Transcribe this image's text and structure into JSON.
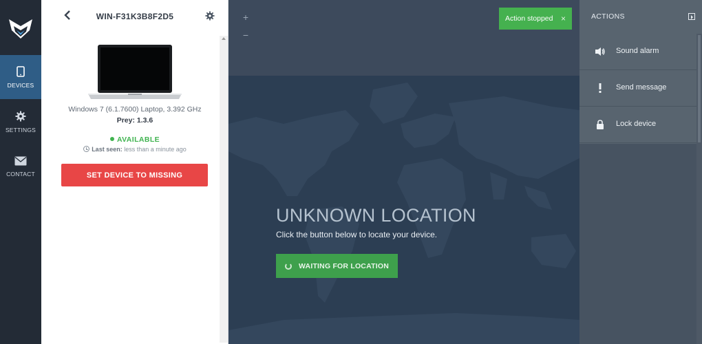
{
  "nav": {
    "items": [
      {
        "label": "DEVICES",
        "icon": "tablet-icon",
        "active": true
      },
      {
        "label": "SETTINGS",
        "icon": "gear-icon",
        "active": false
      },
      {
        "label": "CONTACT",
        "icon": "envelope-icon",
        "active": false
      }
    ]
  },
  "device": {
    "title": "WIN-F31K3B8F2D5",
    "info": "Windows 7 (6.1.7600) Laptop, 3.392 GHz",
    "version": "Prey: 1.3.6",
    "status": "AVAILABLE",
    "last_seen_label": "Last seen:",
    "last_seen_value": "less than a minute ago",
    "missing_button": "SET DEVICE TO MISSING"
  },
  "map": {
    "zoom_in": "+",
    "zoom_out": "−",
    "title": "UNKNOWN LOCATION",
    "subtitle": "Click the button below to locate your device.",
    "waiting_button": "WAITING FOR LOCATION"
  },
  "toast": {
    "text": "Action stopped",
    "close": "×"
  },
  "actions": {
    "header": "ACTIONS",
    "items": [
      {
        "label": "Sound alarm",
        "icon": "speaker-icon"
      },
      {
        "label": "Send message",
        "icon": "exclamation-icon"
      },
      {
        "label": "Lock device",
        "icon": "lock-icon"
      }
    ]
  },
  "colors": {
    "nav_bg": "#232b36",
    "nav_active": "#2f5d86",
    "danger": "#e84646",
    "success": "#3fb34f",
    "map_bg": "#2c3e53",
    "actions_bg": "#58646f"
  }
}
